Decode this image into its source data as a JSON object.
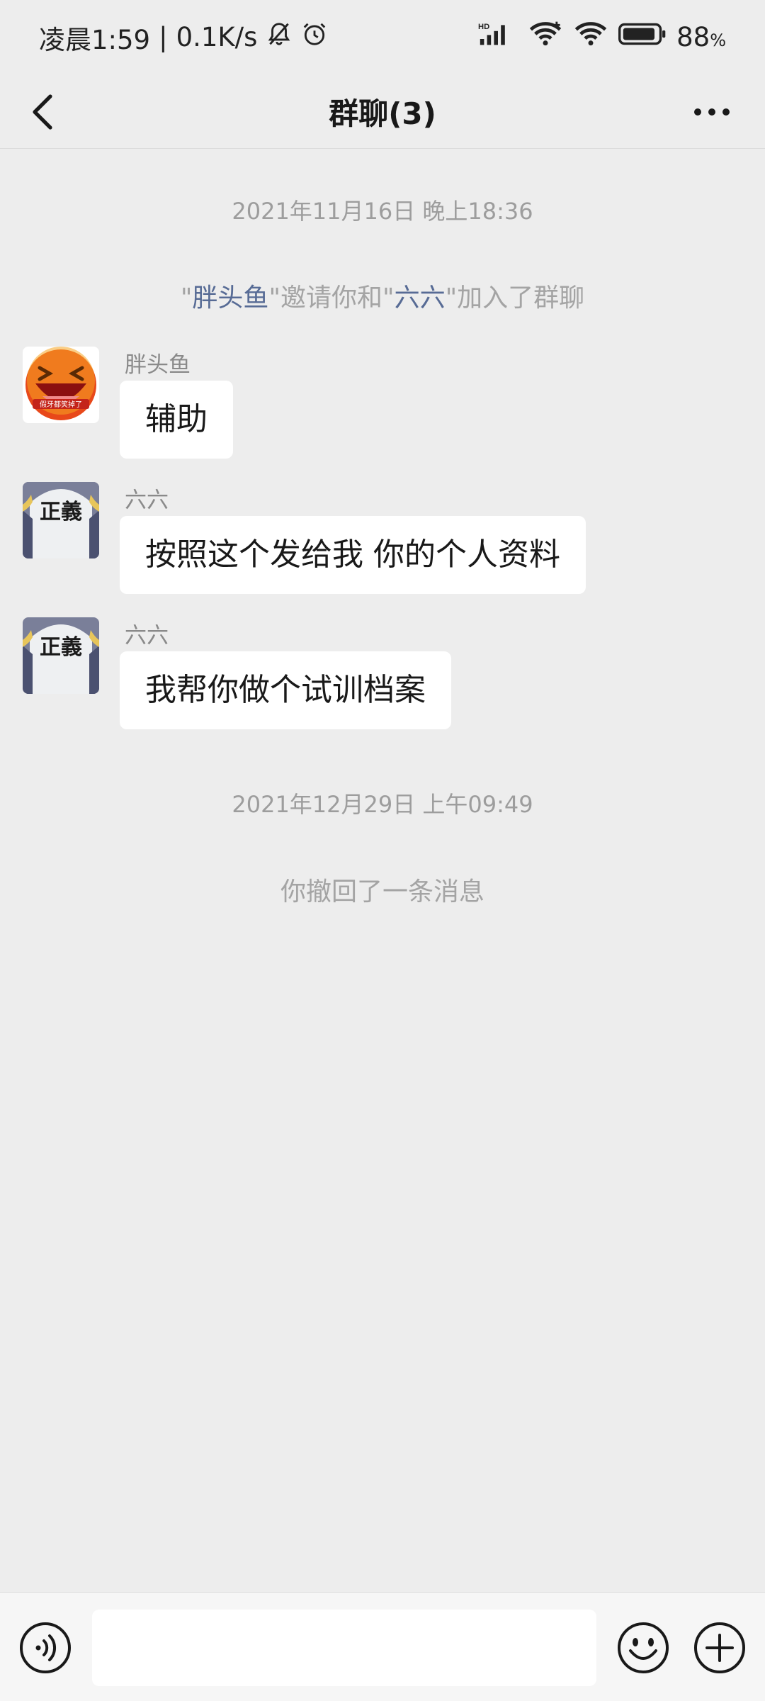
{
  "status_bar": {
    "time": "凌晨1:59",
    "net_speed": "0.1K/s",
    "battery_pct": "88",
    "battery_unit": "%",
    "network_label": "HD"
  },
  "nav": {
    "title": "群聊(3)"
  },
  "chat": {
    "timestamp_1": "2021年11月16日 晚上18:36",
    "invite": {
      "q1": "\"",
      "inviter": "胖头鱼",
      "mid": "\"邀请你和\"",
      "invitee": "六六",
      "end": "\"加入了群聊"
    },
    "messages": [
      {
        "sender": "胖头鱼",
        "text": "辅助",
        "avatar_icon": "laughing-face-avatar",
        "avatar_caption": "假牙都笑掉了"
      },
      {
        "sender": "六六",
        "text": "按照这个发给我 你的个人资料",
        "avatar_icon": "justice-cloak-avatar",
        "avatar_caption": "正義"
      },
      {
        "sender": "六六",
        "text": "我帮你做个试训档案",
        "avatar_icon": "justice-cloak-avatar",
        "avatar_caption": "正義"
      }
    ],
    "timestamp_2": "2021年12月29日 上午09:49",
    "recall_notice": "你撤回了一条消息"
  },
  "input_bar": {
    "voice_icon": "voice-icon",
    "emoji_icon": "emoji-icon",
    "plus_icon": "plus-icon",
    "value": ""
  },
  "colors": {
    "background": "#ededed",
    "bubble": "#ffffff",
    "link_name": "#576b95",
    "meta_text": "#9d9d9d"
  }
}
